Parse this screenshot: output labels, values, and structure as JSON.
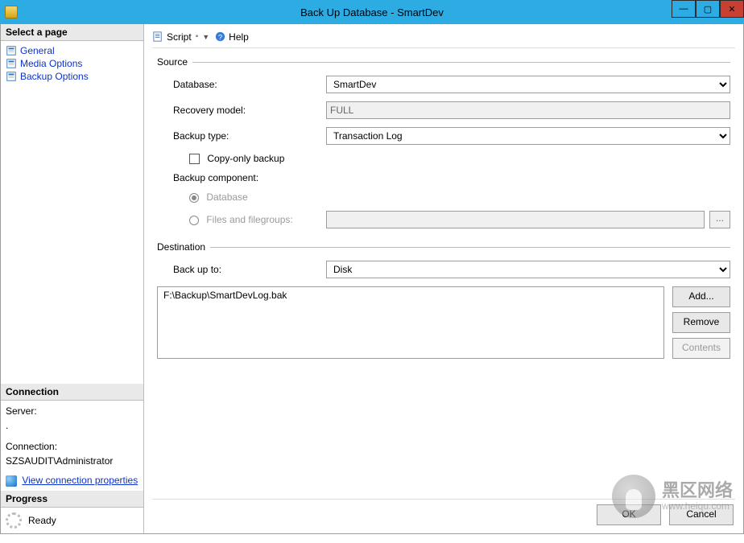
{
  "window": {
    "title": "Back Up Database - SmartDev"
  },
  "sidebar": {
    "selectPage": "Select a page",
    "pages": [
      "General",
      "Media Options",
      "Backup Options"
    ],
    "connectionHead": "Connection",
    "serverLabel": "Server:",
    "serverValue": ".",
    "connectionLabel": "Connection:",
    "connectionValue": "SZSAUDIT\\Administrator",
    "viewProps": "View connection properties",
    "progressHead": "Progress",
    "progressText": "Ready"
  },
  "toolbar": {
    "script": "Script",
    "help": "Help"
  },
  "form": {
    "sourceGroup": "Source",
    "databaseLabel": "Database:",
    "databaseValue": "SmartDev",
    "recoveryLabel": "Recovery model:",
    "recoveryValue": "FULL",
    "backupTypeLabel": "Backup type:",
    "backupTypeValue": "Transaction Log",
    "copyOnly": "Copy-only backup",
    "componentLabel": "Backup component:",
    "componentDatabase": "Database",
    "componentFiles": "Files and filegroups:",
    "destinationGroup": "Destination",
    "backupToLabel": "Back up to:",
    "backupToValue": "Disk",
    "destItems": [
      "F:\\Backup\\SmartDevLog.bak"
    ],
    "addBtn": "Add...",
    "removeBtn": "Remove",
    "contentsBtn": "Contents"
  },
  "footer": {
    "ok": "OK",
    "cancel": "Cancel"
  },
  "watermark": {
    "title": "黑区网络",
    "sub": "www.heiqu.com"
  }
}
